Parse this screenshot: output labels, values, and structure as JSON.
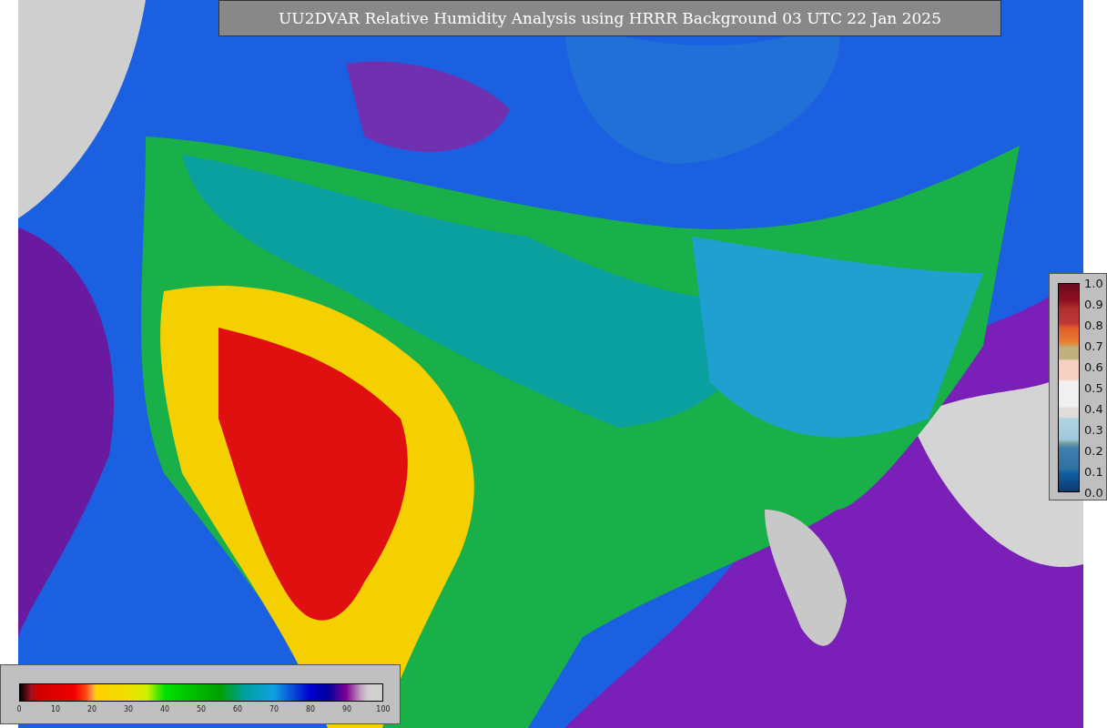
{
  "title": "UU2DVAR Relative Humidity Analysis using HRRR Background 03 UTC 22 Jan 2025",
  "humidity_colorbar": {
    "ticks": [
      "0",
      "10",
      "20",
      "30",
      "40",
      "50",
      "60",
      "70",
      "80",
      "90",
      "100"
    ]
  },
  "station_colorbar": {
    "ticks": [
      "1.0",
      "0.9",
      "0.8",
      "0.7",
      "0.6",
      "0.5",
      "0.4",
      "0.3",
      "0.2",
      "0.1",
      "0.0"
    ]
  }
}
